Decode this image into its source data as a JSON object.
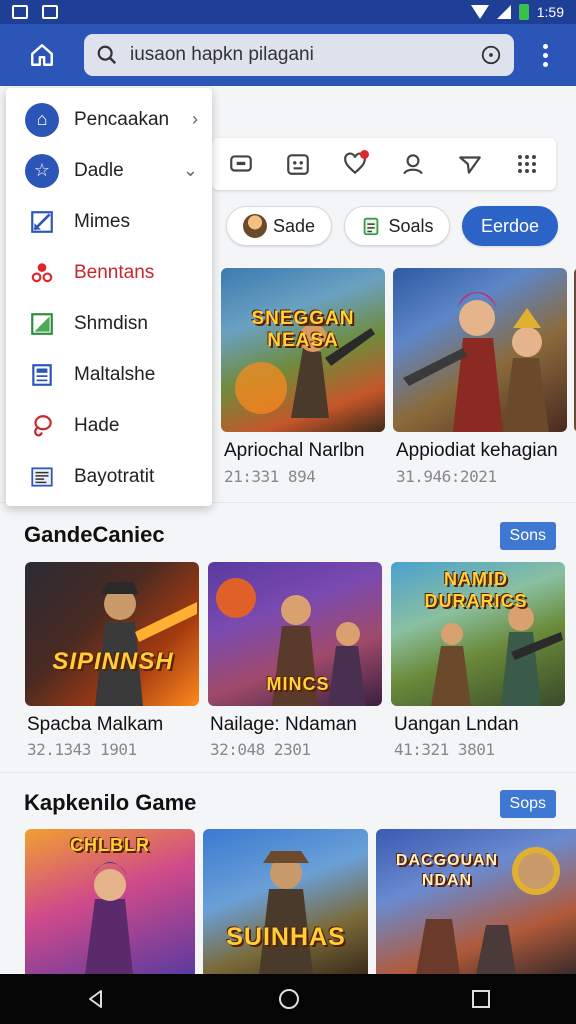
{
  "status_bar": {
    "time": "1:59"
  },
  "search": {
    "value": "iusaon hapkn pilagani"
  },
  "menu": {
    "items": [
      {
        "label": "Pencaakan",
        "icon": "home-icon",
        "arrow": "›"
      },
      {
        "label": "Dadle",
        "icon": "star-badge-icon",
        "arrow": "⌄"
      },
      {
        "label": "Mimes",
        "icon": "edit-square-icon"
      },
      {
        "label": "Benntans",
        "icon": "group-icon"
      },
      {
        "label": "Shmdisn",
        "icon": "chart-triangle-icon"
      },
      {
        "label": "Maltalshe",
        "icon": "document-icon"
      },
      {
        "label": "Hade",
        "icon": "lasso-icon"
      },
      {
        "label": "Bayotratit",
        "icon": "news-icon"
      }
    ]
  },
  "toolbar_icons": [
    "screen-icon",
    "calendar-face-icon",
    "heart-notification-icon",
    "person-icon",
    "send-icon",
    "apps-grid-icon"
  ],
  "chips": [
    {
      "label": "Sade"
    },
    {
      "label": "Soals"
    },
    {
      "label": "Eerdoe"
    }
  ],
  "top_cards": [
    {
      "art_text": "SNEGGAN NEASA",
      "title": "Apriochal Narlbn",
      "sub": "21:331 894"
    },
    {
      "art_text": "",
      "title": "Appiodiat kehagian",
      "sub": "31.946:2021"
    }
  ],
  "section1": {
    "title": "GandeCaniec",
    "see_label": "Sons",
    "cards": [
      {
        "art_text": "SIPINNSH",
        "title": "Spacba Malkam",
        "sub": "32.1343 1901"
      },
      {
        "art_text": "MINCS",
        "title": "Nailage: Ndaman",
        "sub": "32:048 2301"
      },
      {
        "art_text": "NAMID DURARICS",
        "title": "Uangan Lndan",
        "sub": "41:321 3801"
      }
    ]
  },
  "section2": {
    "title": "Kapkenilo Game",
    "see_label": "Sops",
    "cards": [
      {
        "art_text": "CHLBLR"
      },
      {
        "art_text": "SUINHAS"
      },
      {
        "art_text": "DACGOUAN NDAN"
      }
    ]
  },
  "colors": {
    "appbar": "#2c55b8",
    "statusbar": "#1f3f97",
    "accent": "#2c63c6",
    "badge": "#e1262b"
  }
}
